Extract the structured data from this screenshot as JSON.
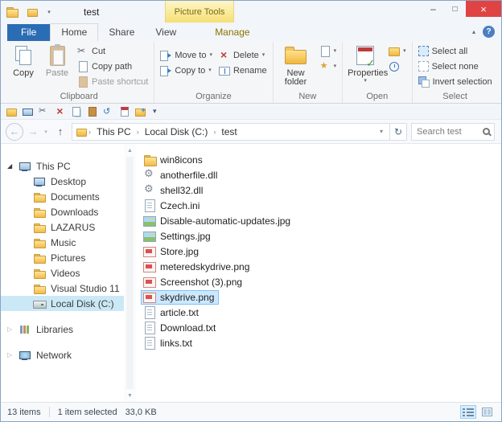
{
  "window": {
    "title": "test",
    "context_group": "Picture Tools"
  },
  "icons": {
    "dropdown": "▾",
    "chevron_up": "▴",
    "help": "?",
    "minimize": "–",
    "maximize": "□",
    "close": "×",
    "back": "←",
    "forward": "→",
    "up": "↑",
    "refresh": "↻",
    "crumb_sep": "›",
    "tree_expanded": "◢",
    "tree_collapsed": "▷",
    "scroll_up": "▲",
    "scroll_down": "▼"
  },
  "ribbon": {
    "tabs": [
      {
        "label": "File"
      },
      {
        "label": "Home"
      },
      {
        "label": "Share"
      },
      {
        "label": "View"
      },
      {
        "label": "Manage"
      }
    ],
    "clipboard": {
      "label": "Clipboard",
      "copy": "Copy",
      "paste": "Paste",
      "cut": "Cut",
      "copy_path": "Copy path",
      "paste_shortcut": "Paste shortcut"
    },
    "organize": {
      "label": "Organize",
      "move_to": "Move to",
      "copy_to": "Copy to",
      "delete": "Delete",
      "rename": "Rename"
    },
    "new_group": {
      "label": "New",
      "new_folder": "New folder"
    },
    "open_group": {
      "label": "Open",
      "properties": "Properties"
    },
    "select_group": {
      "label": "Select",
      "select_all": "Select all",
      "select_none": "Select none",
      "invert": "Invert selection"
    }
  },
  "qat": {
    "icons": [
      "folder",
      "computer",
      "cut",
      "delete",
      "copy",
      "paste",
      "undo",
      "properties",
      "new-folder",
      "customize"
    ]
  },
  "address": {
    "breadcrumbs": [
      "This PC",
      "Local Disk (C:)",
      "test"
    ],
    "search_placeholder": "Search test"
  },
  "sidebar": {
    "items": [
      {
        "label": "This PC",
        "level": 0,
        "icon": "computer",
        "arrow": "expanded"
      },
      {
        "label": "Desktop",
        "level": 1,
        "icon": "desktop"
      },
      {
        "label": "Documents",
        "level": 1,
        "icon": "folder"
      },
      {
        "label": "Downloads",
        "level": 1,
        "icon": "folder"
      },
      {
        "label": "LAZARUS",
        "level": 1,
        "icon": "folder"
      },
      {
        "label": "Music",
        "level": 1,
        "icon": "folder"
      },
      {
        "label": "Pictures",
        "level": 1,
        "icon": "folder"
      },
      {
        "label": "Videos",
        "level": 1,
        "icon": "folder"
      },
      {
        "label": "Visual Studio 11",
        "level": 1,
        "icon": "folder"
      },
      {
        "label": "Local Disk (C:)",
        "level": 1,
        "icon": "disk",
        "selected": true
      },
      {
        "label": "Libraries",
        "level": 0,
        "icon": "library",
        "arrow": "collapsed",
        "gap_before": true
      },
      {
        "label": "Network",
        "level": 0,
        "icon": "network",
        "arrow": "collapsed",
        "gap_before": true
      }
    ]
  },
  "files": [
    {
      "name": "win8icons",
      "icon": "folder"
    },
    {
      "name": "anotherfile.dll",
      "icon": "dll"
    },
    {
      "name": "shell32.dll",
      "icon": "dll"
    },
    {
      "name": "Czech.ini",
      "icon": "ini"
    },
    {
      "name": "Disable-automatic-updates.jpg",
      "icon": "image-green"
    },
    {
      "name": "Settings.jpg",
      "icon": "image-green"
    },
    {
      "name": "Store.jpg",
      "icon": "image-red"
    },
    {
      "name": "meteredskydrive.png",
      "icon": "image-red"
    },
    {
      "name": "Screenshot (3).png",
      "icon": "image-red"
    },
    {
      "name": "skydrive.png",
      "icon": "image-red",
      "selected": true
    },
    {
      "name": "article.txt",
      "icon": "txt"
    },
    {
      "name": "Download.txt",
      "icon": "txt"
    },
    {
      "name": "links.txt",
      "icon": "txt"
    }
  ],
  "statusbar": {
    "items_count": "13 items",
    "selection": "1 item selected",
    "size": "33,0 KB"
  }
}
